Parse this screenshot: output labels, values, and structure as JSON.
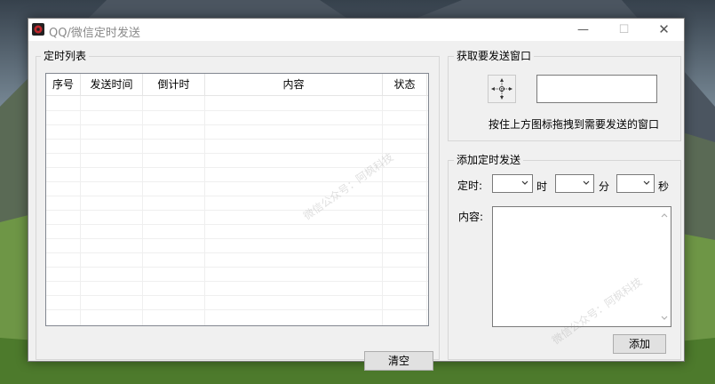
{
  "window": {
    "title": "QQ/微信定时发送",
    "min_glyph": "—",
    "max_glyph": "☐",
    "close_glyph": "✕"
  },
  "timer_list": {
    "group_label": "定时列表",
    "columns": [
      "序号",
      "发送时间",
      "倒计时",
      "内容",
      "状态"
    ],
    "rows": [],
    "clear_button": "清空"
  },
  "get_window": {
    "group_label": "获取要发送窗口",
    "window_value": "",
    "hint": "按住上方图标拖拽到需要发送的窗口"
  },
  "add_timer": {
    "group_label": "添加定时发送",
    "time_label": "定时:",
    "hour_unit": "时",
    "minute_unit": "分",
    "second_unit": "秒",
    "hour_value": "",
    "minute_value": "",
    "second_value": "",
    "content_label": "内容:",
    "content_value": "",
    "add_button": "添加"
  },
  "watermark": "微信公众号：阿枫科技"
}
